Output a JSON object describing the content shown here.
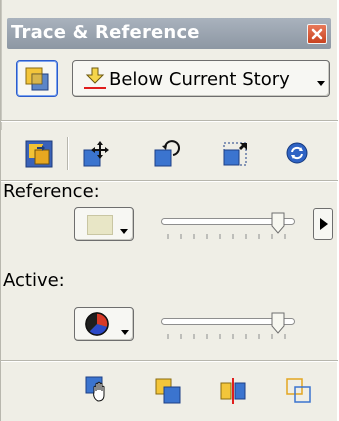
{
  "panel": {
    "title": "Trace & Reference",
    "close_icon": "close-icon"
  },
  "layer_position": {
    "selected_label": "Below Current Story",
    "icon": "layer-stack-icon",
    "below_icon": "arrow-down-red-line-icon"
  },
  "toolbar": {
    "items": [
      {
        "name": "swap-layers-icon"
      },
      {
        "name": "move-reference-icon"
      },
      {
        "name": "rotate-reference-icon"
      },
      {
        "name": "scale-reference-icon"
      },
      {
        "name": "reset-reference-icon"
      }
    ]
  },
  "reference": {
    "label": "Reference:",
    "swatch_color": "#e8e6c6",
    "opacity": 0.92
  },
  "active": {
    "label": "Active:",
    "swatch_icon": "color-wheel-icon",
    "opacity": 0.92
  },
  "bottom_toolbar": {
    "items": [
      {
        "name": "hand-pan-icon"
      },
      {
        "name": "bring-forward-icon"
      },
      {
        "name": "split-view-icon"
      },
      {
        "name": "overlap-icon"
      }
    ]
  },
  "colors": {
    "title_bar": "#959fab",
    "panel_bg": "#efeee6",
    "accent_blue": "#2a62d6",
    "close_red": "#d5532e"
  }
}
